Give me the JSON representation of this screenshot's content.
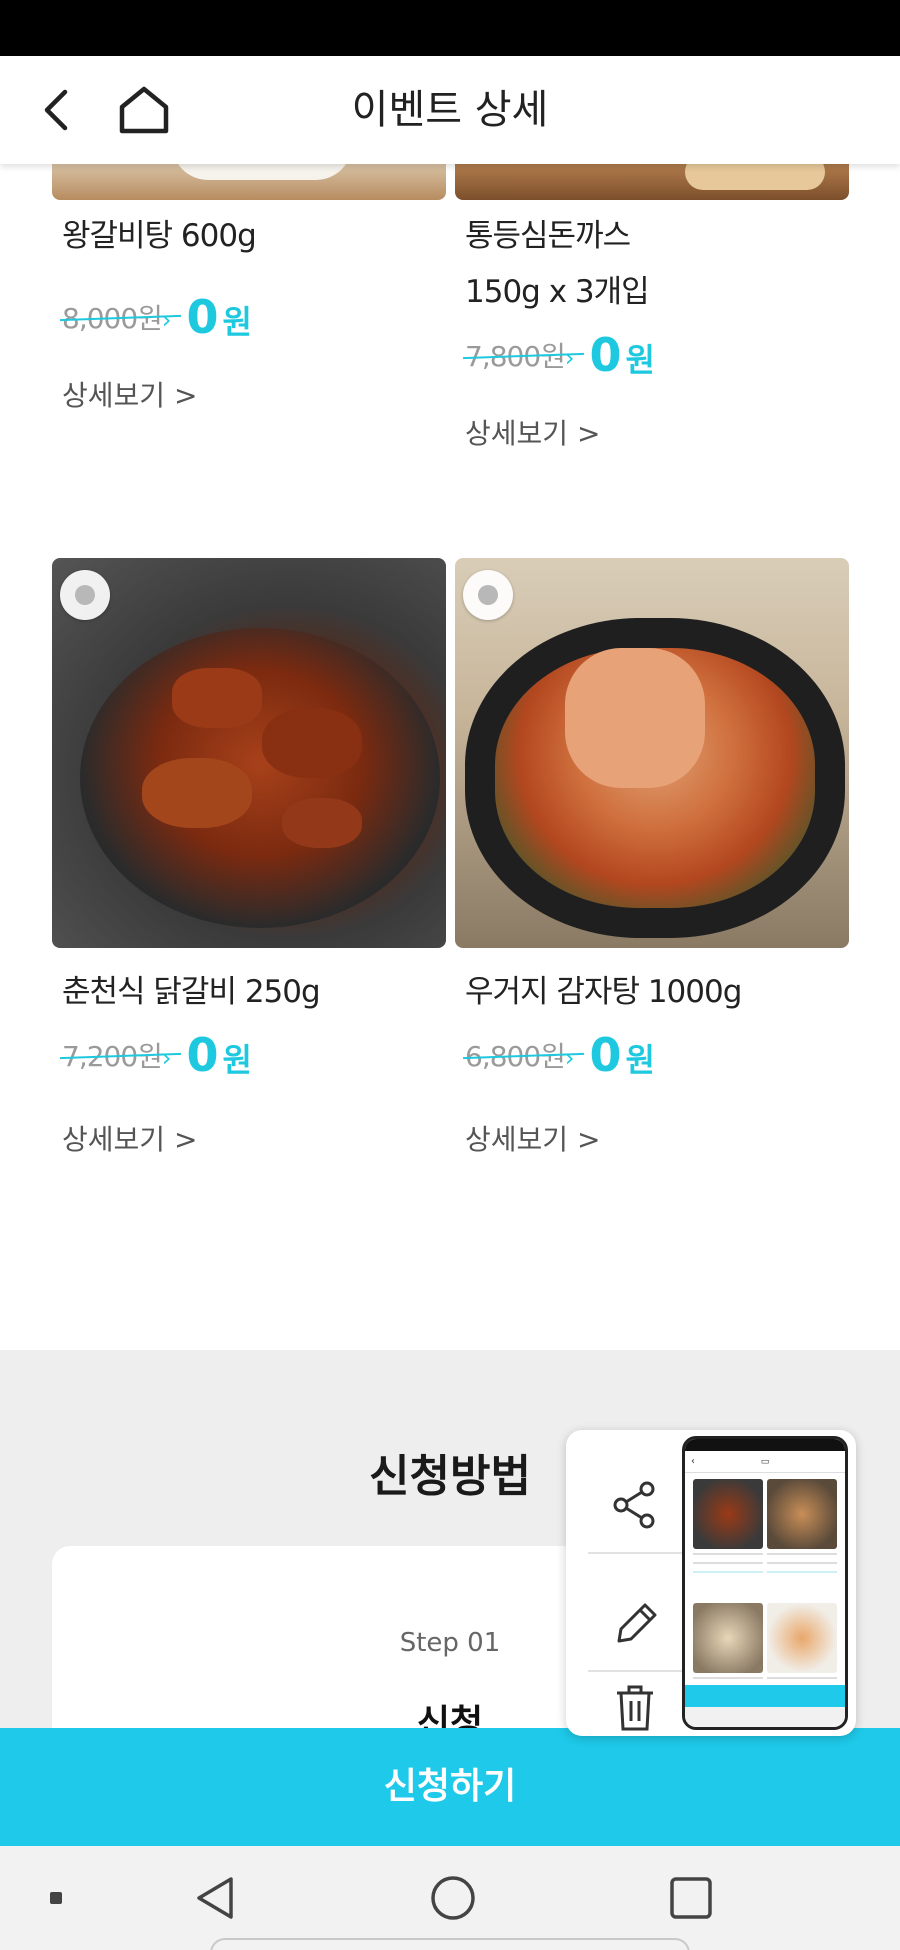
{
  "header": {
    "title": "이벤트 상세",
    "back_icon": "chevron-left-icon",
    "home_icon": "home-icon"
  },
  "products": [
    {
      "name_lines": [
        "왕갈비탕 600g"
      ],
      "original_price": "8,000원",
      "price_num": "0",
      "price_unit": "원",
      "detail_label": "상세보기 >"
    },
    {
      "name_lines": [
        "통등심돈까스",
        "150g x 3개입"
      ],
      "original_price": "7,800원",
      "price_num": "0",
      "price_unit": "원",
      "detail_label": "상세보기 >"
    },
    {
      "name_lines": [
        "춘천식 닭갈비 250g"
      ],
      "original_price": "7,200원",
      "price_num": "0",
      "price_unit": "원",
      "detail_label": "상세보기 >"
    },
    {
      "name_lines": [
        "우거지 감자탕 1000g"
      ],
      "original_price": "6,800원",
      "price_num": "0",
      "price_unit": "원",
      "detail_label": "상세보기 >"
    }
  ],
  "apply_section": {
    "title": "신청방법",
    "step_label": "Step 01",
    "step_title": "신청"
  },
  "apply_button": {
    "label": "신청하기"
  },
  "screenshot_popup": {
    "actions": [
      "share-icon",
      "edit-icon",
      "delete-icon"
    ]
  },
  "colors": {
    "accent": "#1ec9e9",
    "price": "#1ec9e0",
    "status_bar": "#000000",
    "section_bg": "#eeeeee"
  }
}
